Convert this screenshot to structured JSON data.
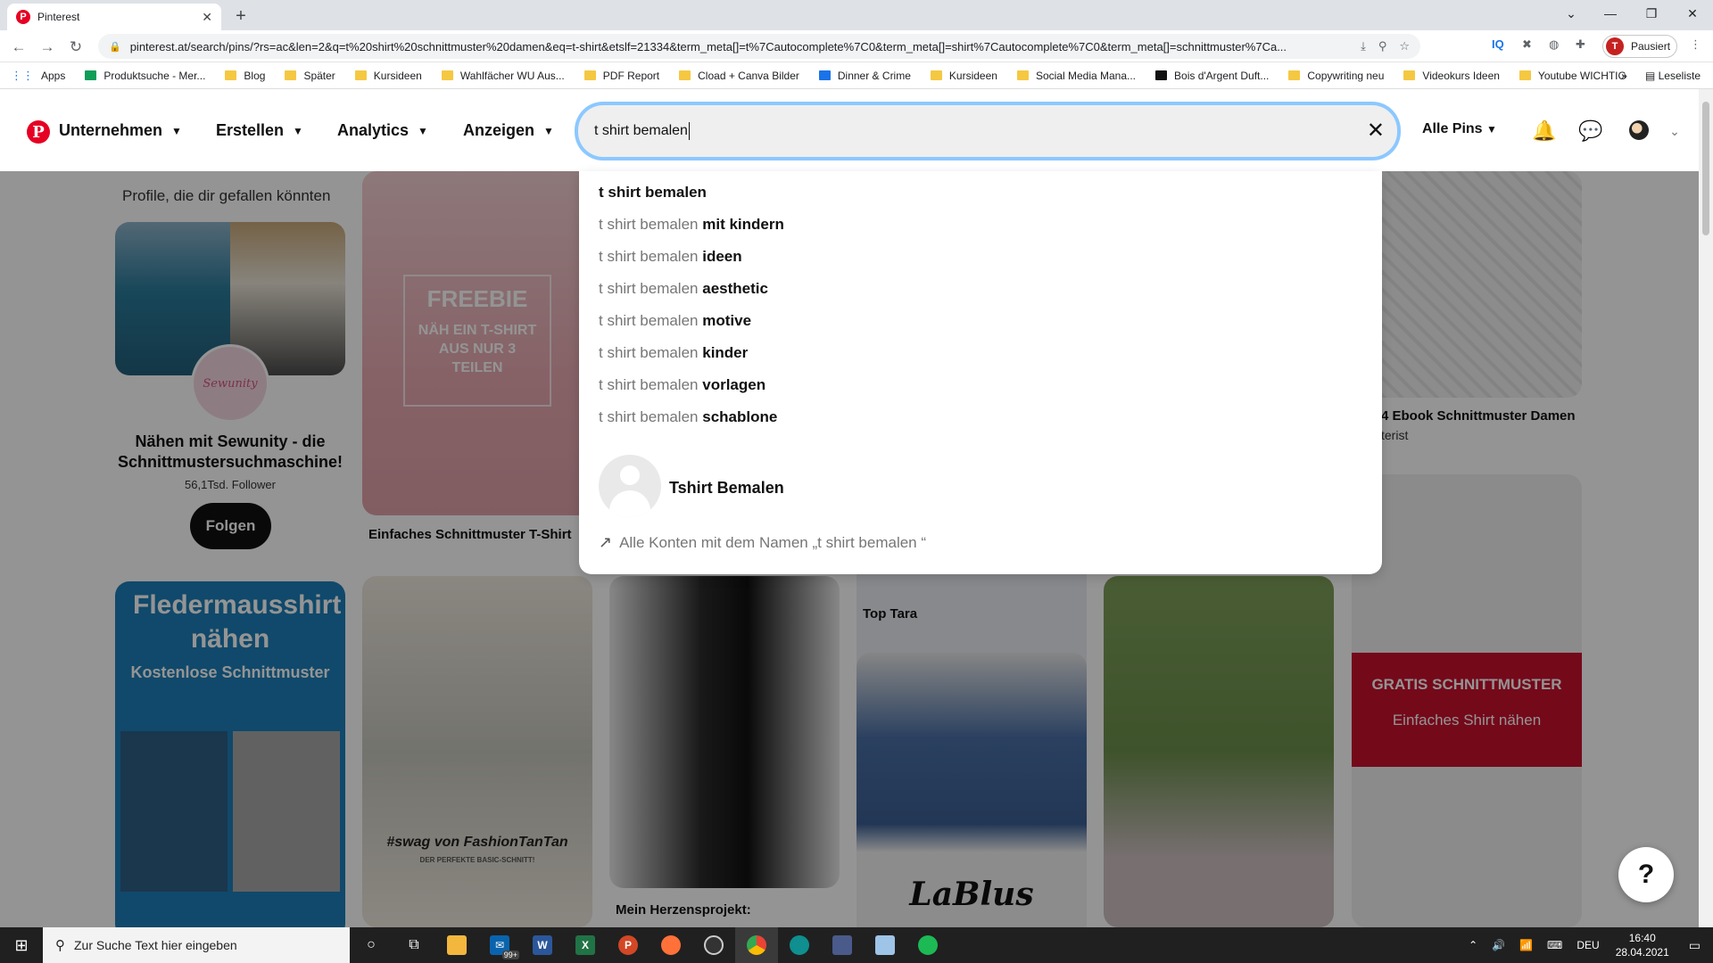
{
  "browser": {
    "tab_title": "Pinterest",
    "url": "pinterest.at/search/pins/?rs=ac&len=2&q=t%20shirt%20schnittmuster%20damen&eq=t-shirt&etslf=21334&term_meta[]=t%7Cautocomplete%7C0&term_meta[]=shirt%7Cautocomplete%7C0&term_meta[]=schnittmuster%7Ca...",
    "profile_label": "Pausiert",
    "profile_initial": "T",
    "bookmarks": [
      "Apps",
      "Produktsuche - Mer...",
      "Blog",
      "Später",
      "Kursideen",
      "Wahlfächer WU Aus...",
      "PDF Report",
      "Cload + Canva Bilder",
      "Dinner & Crime",
      "Kursideen",
      "Social Media Mana...",
      "Bois d'Argent Duft...",
      "Copywriting neu",
      "Videokurs Ideen",
      "Youtube WICHTIG"
    ],
    "bookmarks_more": "»",
    "reading_list": "Leseliste"
  },
  "header": {
    "nav": [
      "Unternehmen",
      "Erstellen",
      "Analytics",
      "Anzeigen"
    ],
    "search_value": "t shirt bemalen",
    "filter_label": "Alle Pins"
  },
  "content": {
    "profiles_title": "Profile, die dir gefallen könnten",
    "profile_logo": "Sewunity",
    "profile_name": "Nähen mit Sewunity - die Schnittmustersuchmaschine!",
    "profile_followers": "56,1Tsd. Follower",
    "follow_label": "Folgen",
    "pins": {
      "freebie_title": "FREEBIE",
      "freebie_sub": "NÄH EIN T-SHIRT AUS NUR 3 TEILEN",
      "freebie_caption": "Einfaches Schnittmuster T-Shirt",
      "ebook_caption": "4 Ebook Schnittmuster Damen",
      "ebook_sub": "terist",
      "fledermaus_title": "Fledermausshirt nähen",
      "fledermaus_sub": "Kostenlose Schnittmuster",
      "swag_text": "#swag von FashionTanTan",
      "swag_sub": "DER PERFEKTE BASIC-SCHNITT!",
      "herzens_caption": "Mein Herzensprojekt:",
      "toptara_caption": "Top Tara",
      "lablus_text": "LaBlus",
      "gratis_title": "GRATIS SCHNITTMUSTER",
      "gratis_sub": "Einfaches Shirt nähen"
    }
  },
  "dropdown": {
    "first": "t shirt bemalen",
    "prefix": "t shirt bemalen",
    "suggestions": [
      "mit kindern",
      "ideen",
      "aesthetic",
      "motive",
      "kinder",
      "vorlagen",
      "schablone"
    ],
    "account_name": "Tshirt Bemalen",
    "all_accounts": "Alle Konten mit dem Namen „t shirt bemalen “"
  },
  "help_label": "?",
  "taskbar": {
    "search_placeholder": "Zur Suche Text hier eingeben",
    "mail_badge": "99+",
    "language": "DEU",
    "time": "16:40",
    "date": "28.04.2021"
  },
  "colors": {
    "pinterest_red": "#e60023",
    "focus_ring": "#0084ff",
    "gratis_red": "#c8102e",
    "fledermaus_blue": "#1d7fb8"
  }
}
